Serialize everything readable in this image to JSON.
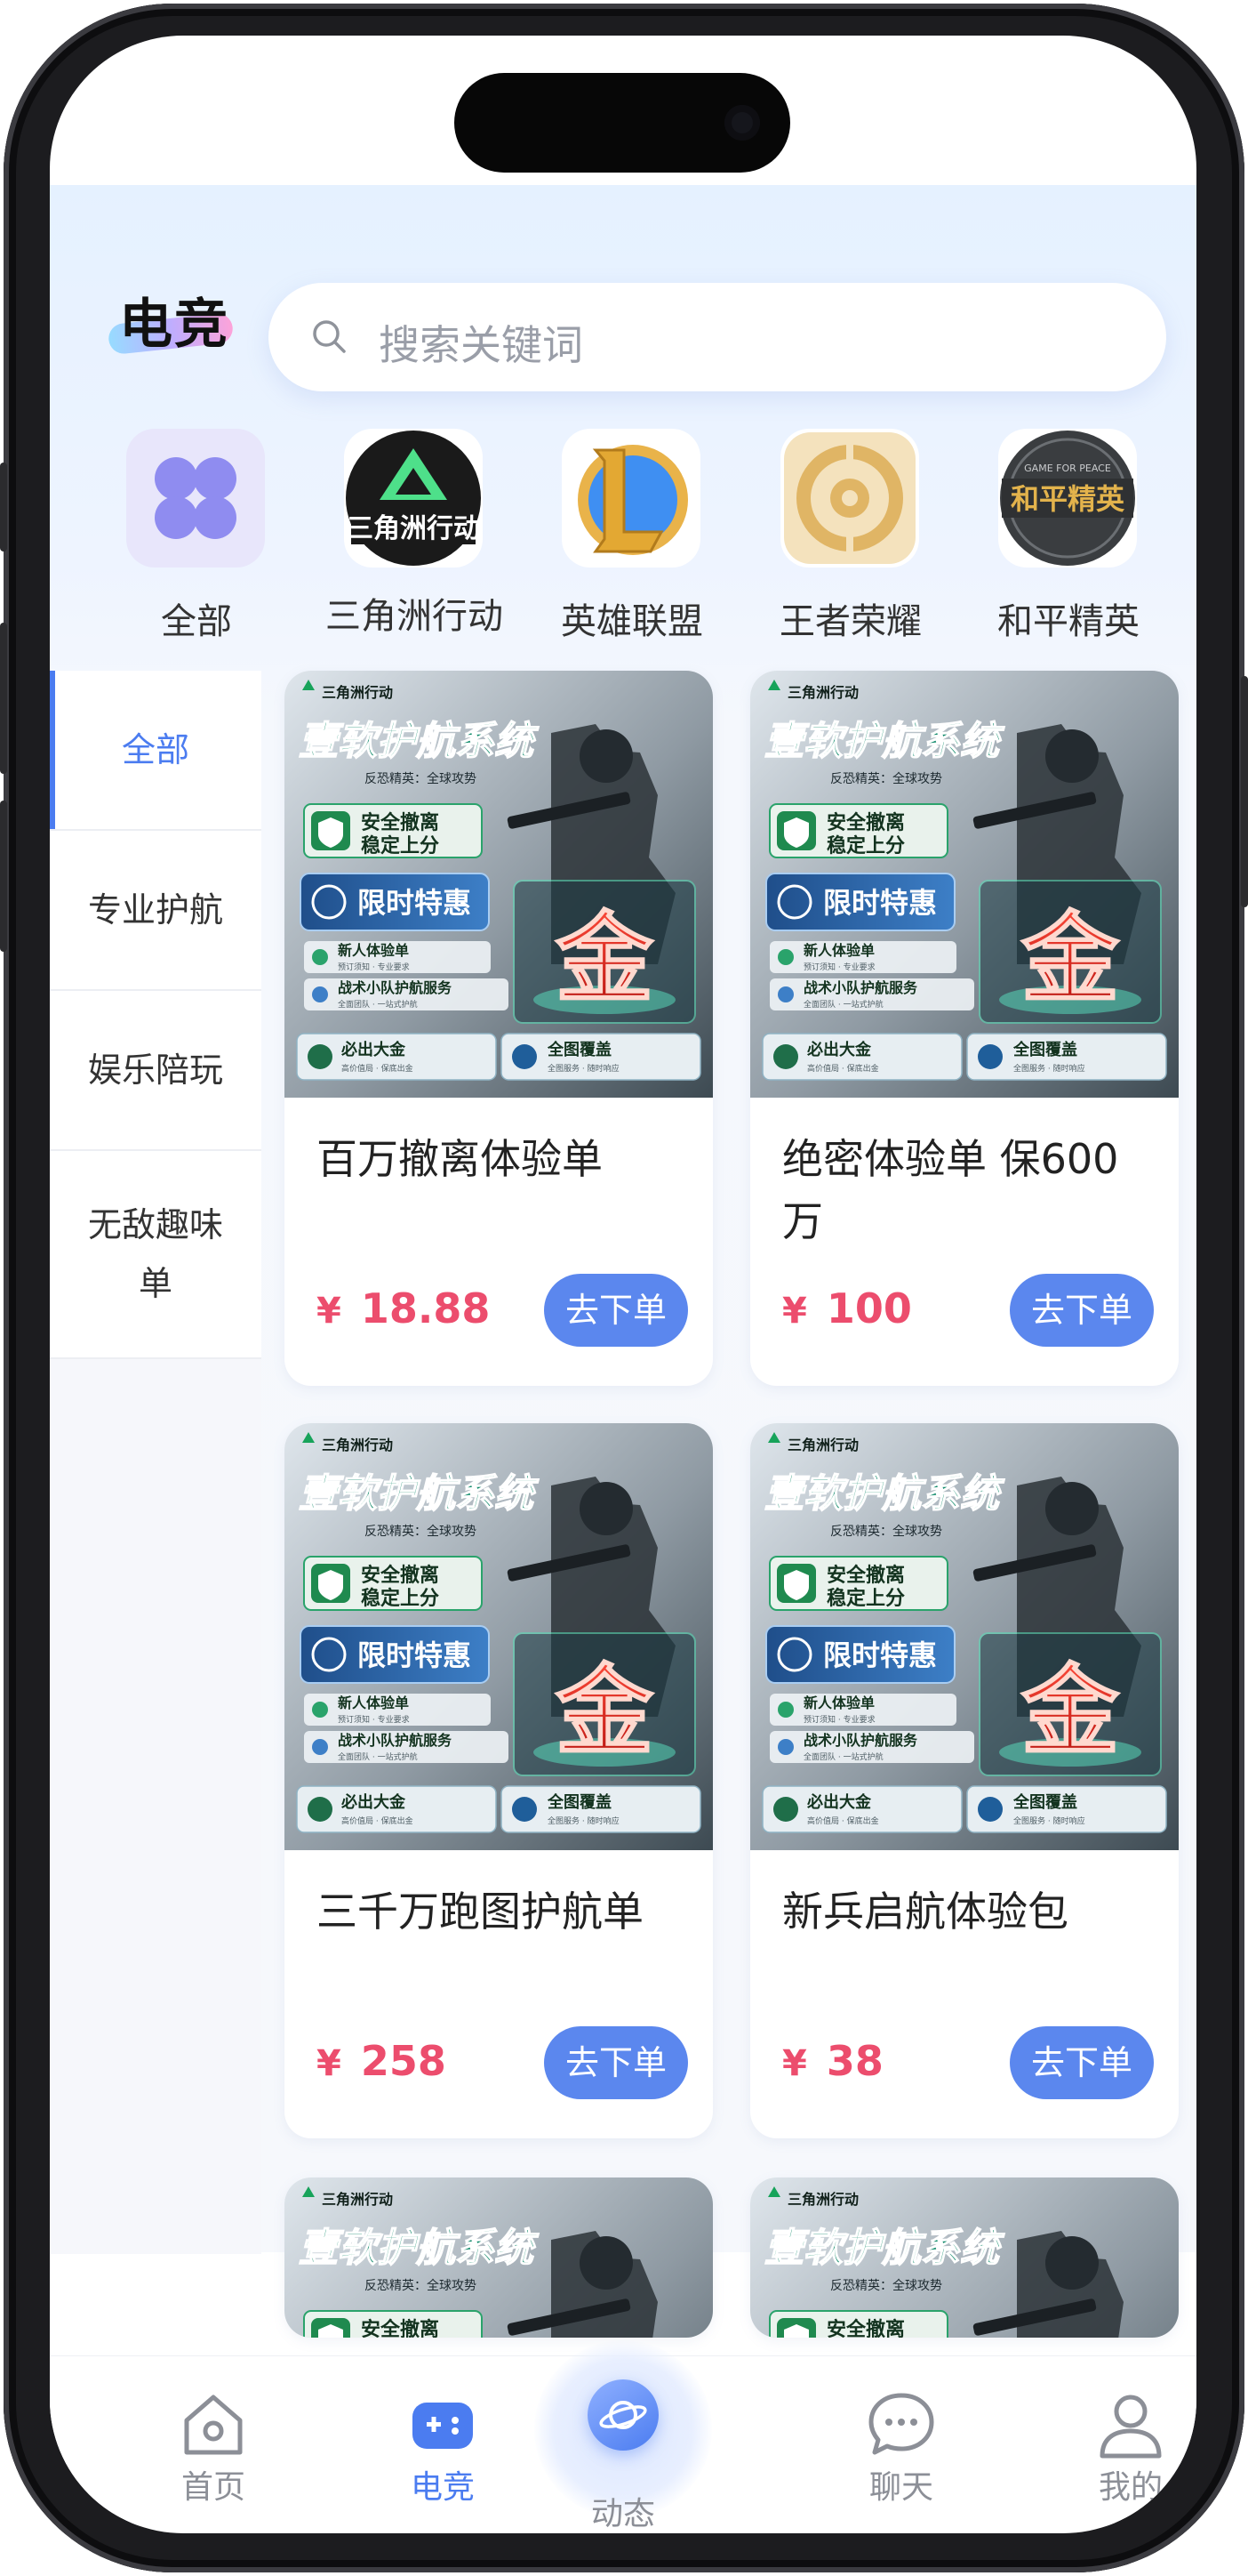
{
  "header": {
    "brand": "电竞",
    "search_placeholder": "搜索关键词"
  },
  "categories": [
    {
      "label": "全部",
      "icon": "grid-icon"
    },
    {
      "label": "三角洲行动",
      "icon": "delta-force-logo",
      "logo_text": "三角洲行动"
    },
    {
      "label": "英雄联盟",
      "icon": "league-of-legends-logo"
    },
    {
      "label": "王者荣耀",
      "icon": "honor-of-kings-logo"
    },
    {
      "label": "和平精英",
      "icon": "peace-elite-logo",
      "logo_text": "和平精英",
      "logo_small_text": "GAME FOR PEACE"
    }
  ],
  "sidebar": {
    "items": [
      {
        "label": "全部",
        "active": true
      },
      {
        "label": "专业护航",
        "active": false
      },
      {
        "label": "娱乐陪玩",
        "active": false
      },
      {
        "label": "无敌趣味单",
        "active": false
      }
    ]
  },
  "poster": {
    "brand": "三角洲行动",
    "headline": "壹软护航系统",
    "sub": "反恐精英：全球攻势",
    "badge1": "安全撤离\n稳定上分",
    "badge2": "限时特惠",
    "row1": "新人体验单",
    "row1_sub": "预订须知 · 专业要求",
    "row2": "战术小队护航服务",
    "row2_sub": "全面团队 · 一站式护航",
    "foot1": "必出大金",
    "foot1_sub": "高价值局 · 保底出金",
    "foot2": "全图覆盖",
    "foot2_sub": "全图服务 · 随时响应",
    "gold": "金"
  },
  "products": [
    {
      "title": "百万撤离体验单",
      "currency": "¥",
      "price": "18.88",
      "action": "去下单"
    },
    {
      "title": "绝密体验单 保600万",
      "currency": "¥",
      "price": "100",
      "action": "去下单"
    },
    {
      "title": "三千万跑图护航单",
      "currency": "¥",
      "price": "258",
      "action": "去下单"
    },
    {
      "title": "新兵启航体验包",
      "currency": "¥",
      "price": "38",
      "action": "去下单"
    }
  ],
  "tabbar": {
    "items": [
      {
        "label": "首页",
        "icon": "home-icon",
        "active": false
      },
      {
        "label": "电竞",
        "icon": "gamepad-icon",
        "active": true
      },
      {
        "label": "动态",
        "icon": "planet-icon",
        "active": false
      },
      {
        "label": "聊天",
        "icon": "chat-icon",
        "active": false
      },
      {
        "label": "我的",
        "icon": "user-icon",
        "active": false
      }
    ]
  },
  "colors": {
    "accent": "#4b7cf0",
    "price": "#ec4d6d",
    "button": "#5b87ee"
  }
}
